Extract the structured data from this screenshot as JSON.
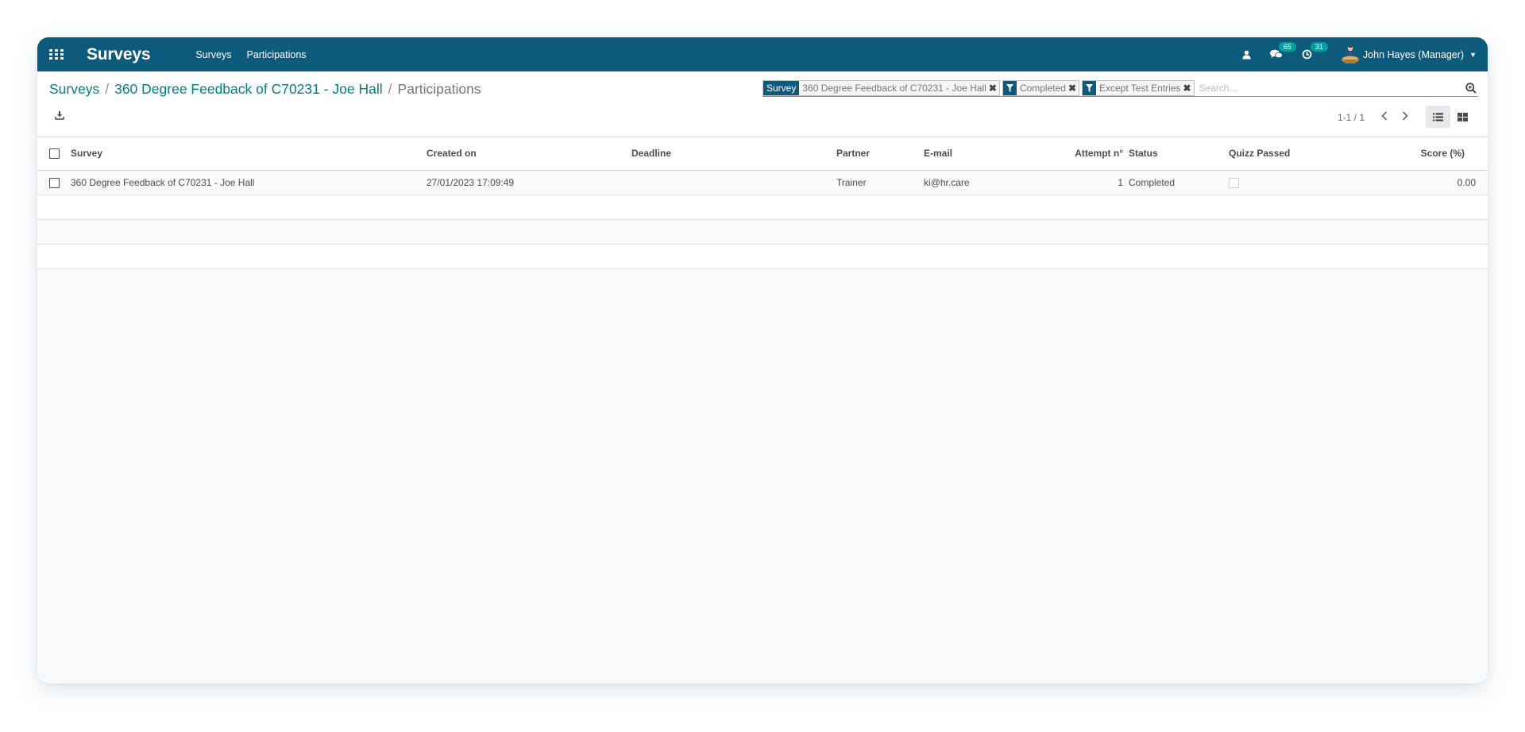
{
  "navbar": {
    "brand": "Surveys",
    "menu": [
      "Surveys",
      "Participations"
    ],
    "messages_count": "65",
    "activities_count": "31",
    "user_name": "John Hayes (Manager)"
  },
  "breadcrumb": {
    "items": [
      "Surveys",
      "360 Degree Feedback of C70231 - Joe Hall"
    ],
    "current": "Participations"
  },
  "search": {
    "facets": [
      {
        "label": "Survey",
        "value": "360 Degree Feedback of C70231 - Joe Hall"
      },
      {
        "label": "",
        "icon": "filter-icon",
        "value": "Completed"
      },
      {
        "label": "",
        "icon": "filter-icon",
        "value": "Except Test Entries"
      }
    ],
    "placeholder": "Search..."
  },
  "pager": {
    "value": "1-1 / 1"
  },
  "table": {
    "columns": [
      "Survey",
      "Created on",
      "Deadline",
      "Partner",
      "E-mail",
      "Attempt n°",
      "Status",
      "Quizz Passed",
      "Score (%)"
    ],
    "rows": [
      {
        "survey": "360 Degree Feedback of C70231 - Joe Hall",
        "created_on": "27/01/2023 17:09:49",
        "deadline": "",
        "partner": "Trainer",
        "email": "ki@hr.care",
        "attempt": "1",
        "status": "Completed",
        "quizz_passed": false,
        "score": "0.00"
      }
    ]
  },
  "colors": {
    "navbar": "#0e5a7c",
    "badge": "#00a09d",
    "link": "#017e84"
  }
}
